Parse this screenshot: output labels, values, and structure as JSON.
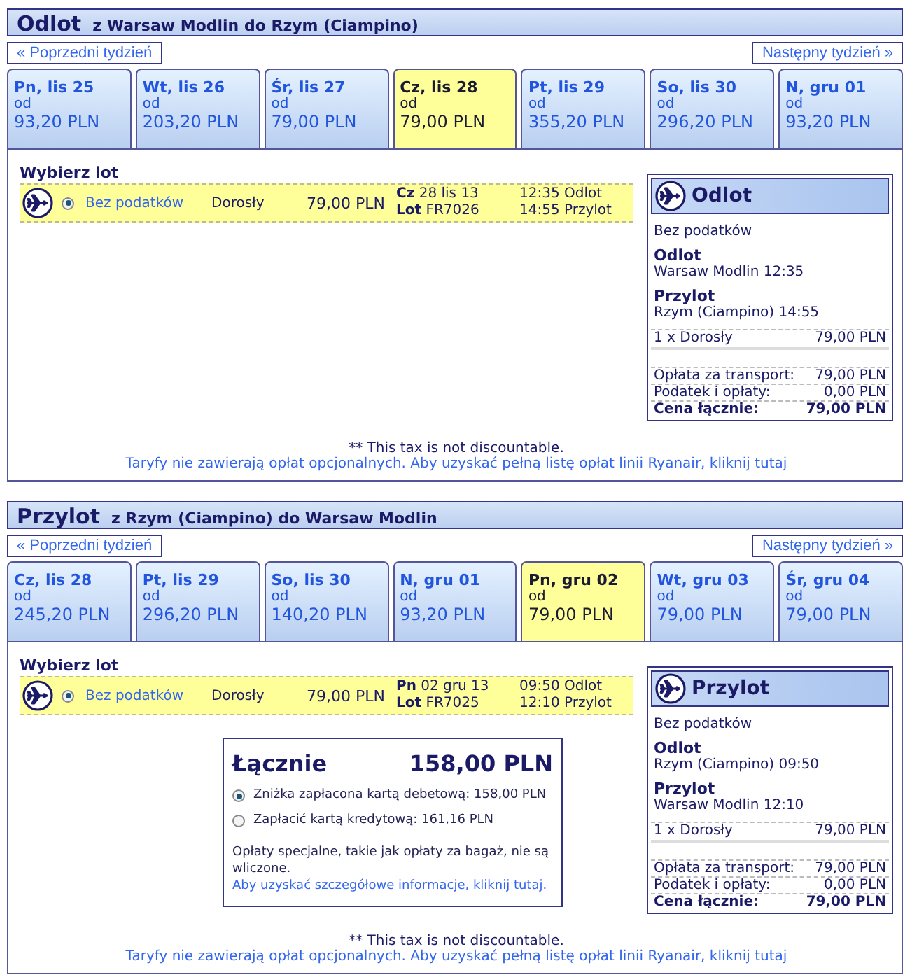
{
  "sections": [
    {
      "title": "Odlot",
      "route": "z Warsaw Modlin do Rzym (Ciampino)",
      "prev_week": "« Poprzedni tydzień",
      "next_week": "Następny tydzień »",
      "days": [
        {
          "day": "Pn, lis 25",
          "from": "od",
          "price": "93,20 PLN",
          "selected": false
        },
        {
          "day": "Wt, lis 26",
          "from": "od",
          "price": "203,20 PLN",
          "selected": false
        },
        {
          "day": "Śr, lis 27",
          "from": "od",
          "price": "79,00 PLN",
          "selected": false
        },
        {
          "day": "Cz, lis 28",
          "from": "od",
          "price": "79,00 PLN",
          "selected": true
        },
        {
          "day": "Pt, lis 29",
          "from": "od",
          "price": "355,20 PLN",
          "selected": false
        },
        {
          "day": "So, lis 30",
          "from": "od",
          "price": "296,20 PLN",
          "selected": false
        },
        {
          "day": "N, gru 01",
          "from": "od",
          "price": "93,20 PLN",
          "selected": false
        }
      ],
      "choose_label": "Wybierz lot",
      "flight": {
        "fare": "Bez podatków",
        "selected": true,
        "passenger": "Dorosły",
        "price": "79,00 PLN",
        "date_label": "Cz",
        "date": "28 lis 13",
        "flight_label": "Lot",
        "flight_no": "FR7026",
        "depart": "12:35 Odlot",
        "arrive": "14:55 Przylot"
      },
      "summary": {
        "title": "Odlot",
        "fare": "Bez podatków",
        "dep_label": "Odlot",
        "dep": "Warsaw Modlin 12:35",
        "arr_label": "Przylot",
        "arr": "Rzym (Ciampino) 14:55",
        "passenger_line": {
          "label": "1 x Dorosły",
          "value": "79,00 PLN"
        },
        "fees": [
          {
            "label": "Opłata za transport:",
            "value": "79,00 PLN"
          },
          {
            "label": "Podatek i opłaty:",
            "value": "0,00 PLN"
          }
        ],
        "total": {
          "label": "Cena łącznie:",
          "value": "79,00 PLN"
        }
      },
      "tax_note": "** This tax is not discountable.",
      "fares_link": "Taryfy nie zawierają opłat opcjonalnych. Aby uzyskać pełną listę opłat linii Ryanair, kliknij tutaj"
    },
    {
      "title": "Przylot",
      "route": "z Rzym (Ciampino) do Warsaw Modlin",
      "prev_week": "« Poprzedni tydzień",
      "next_week": "Następny tydzień »",
      "days": [
        {
          "day": "Cz, lis 28",
          "from": "od",
          "price": "245,20 PLN",
          "selected": false
        },
        {
          "day": "Pt, lis 29",
          "from": "od",
          "price": "296,20 PLN",
          "selected": false
        },
        {
          "day": "So, lis 30",
          "from": "od",
          "price": "140,20 PLN",
          "selected": false
        },
        {
          "day": "N, gru 01",
          "from": "od",
          "price": "93,20 PLN",
          "selected": false
        },
        {
          "day": "Pn, gru 02",
          "from": "od",
          "price": "79,00 PLN",
          "selected": true
        },
        {
          "day": "Wt, gru 03",
          "from": "od",
          "price": "79,00 PLN",
          "selected": false
        },
        {
          "day": "Śr, gru 04",
          "from": "od",
          "price": "79,00 PLN",
          "selected": false
        }
      ],
      "choose_label": "Wybierz lot",
      "flight": {
        "fare": "Bez podatków",
        "selected": true,
        "passenger": "Dorosły",
        "price": "79,00 PLN",
        "date_label": "Pn",
        "date": "02 gru 13",
        "flight_label": "Lot",
        "flight_no": "FR7025",
        "depart": "09:50 Odlot",
        "arrive": "12:10 Przylot"
      },
      "total_box": {
        "title": "Łącznie",
        "amount": "158,00 PLN",
        "options": [
          {
            "label": "Zniżka zapłacona kartą debetową: 158,00 PLN",
            "selected": true
          },
          {
            "label": "Zapłacić kartą kredytową: 161,16 PLN",
            "selected": false
          }
        ],
        "note": "Opłaty specjalne, takie jak opłaty za bagaż, nie są wliczone.",
        "note_link": "Aby uzyskać szczegółowe informacje, kliknij tutaj."
      },
      "summary": {
        "title": "Przylot",
        "fare": "Bez podatków",
        "dep_label": "Odlot",
        "dep": "Rzym (Ciampino) 09:50",
        "arr_label": "Przylot",
        "arr": "Warsaw Modlin 12:10",
        "passenger_line": {
          "label": "1 x Dorosły",
          "value": "79,00 PLN"
        },
        "fees": [
          {
            "label": "Opłata za transport:",
            "value": "79,00 PLN"
          },
          {
            "label": "Podatek i opłaty:",
            "value": "0,00 PLN"
          }
        ],
        "total": {
          "label": "Cena łącznie:",
          "value": "79,00 PLN"
        }
      },
      "tax_note": "** This tax is not discountable.",
      "fares_link": "Taryfy nie zawierają opłat opcjonalnych. Aby uzyskać pełną listę opłat linii Ryanair, kliknij tutaj"
    }
  ]
}
